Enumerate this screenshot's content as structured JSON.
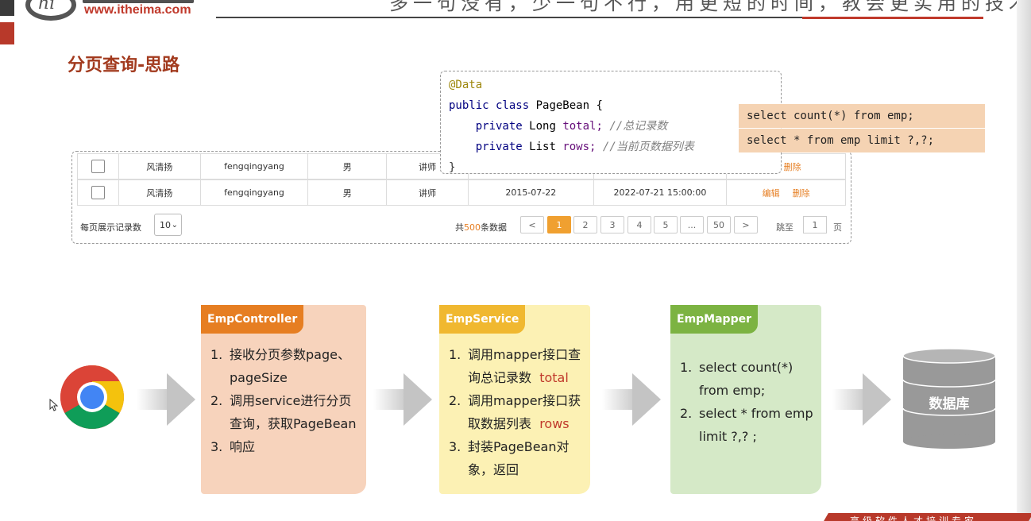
{
  "header": {
    "logo_url_text": "www.itheima.com",
    "slogan": "多一句没有，少一句不行，用更短的时间，教会更实用的技术!"
  },
  "slide": {
    "title": "分页查询-思路"
  },
  "table": {
    "rows": [
      {
        "name": "风清扬",
        "username": "fengqingyang",
        "gender": "男",
        "job": "讲师",
        "entry_date": "",
        "update_time": "",
        "edit": "",
        "delete": "删除"
      },
      {
        "name": "风清扬",
        "username": "fengqingyang",
        "gender": "男",
        "job": "讲师",
        "entry_date": "2015-07-22",
        "update_time": "2022-07-21 15:00:00",
        "edit": "编辑",
        "delete": "删除"
      }
    ]
  },
  "pager": {
    "page_size_label": "每页展示记录数",
    "page_size_value": "10",
    "total_prefix": "共",
    "total_value": "500",
    "total_suffix": "条数据",
    "prev": "<",
    "pages": [
      "1",
      "2",
      "3",
      "4",
      "5",
      "...",
      "50"
    ],
    "active_page": "1",
    "next": ">",
    "jump_label": "跳至",
    "jump_value": "1",
    "page_suffix": "页"
  },
  "code": {
    "annotation": "@Data",
    "class_decl_kw": "public class",
    "class_name": "PageBean {",
    "field1_kw": "private",
    "field1_type": "Long",
    "field1_name": "total;",
    "field1_comment": "//总记录数",
    "field2_kw": "private",
    "field2_type": "List",
    "field2_name": "rows;",
    "field2_comment": "//当前页数据列表",
    "close": "}"
  },
  "sql": {
    "count": "select count(*) from emp;",
    "page": "select * from emp limit ?,?;"
  },
  "flow": {
    "controller": {
      "tag": "EmpController",
      "items": [
        {
          "idx": "1.",
          "text": "接收分页参数page、pageSize"
        },
        {
          "idx": "2.",
          "text": "调用service进行分页查询，获取PageBean"
        },
        {
          "idx": "3.",
          "text": "响应"
        }
      ]
    },
    "service": {
      "tag": "EmpService",
      "item1_idx": "1.",
      "item1_text": "调用mapper接口查询总记录数",
      "item1_hl": "total",
      "item2_idx": "2.",
      "item2_text": "调用mapper接口获取数据列表",
      "item2_hl": "rows",
      "item3_idx": "3.",
      "item3_text": "封装PageBean对象，返回"
    },
    "mapper": {
      "tag": "EmpMapper",
      "items": [
        {
          "idx": "1.",
          "text": "select count(*) from emp;"
        },
        {
          "idx": "2.",
          "text": "select * from emp limit ?,? ;"
        }
      ]
    },
    "db_label": "数据库"
  },
  "footer": {
    "text": "高级软件人才培训专家"
  },
  "colors": {
    "title": "#a23a1e",
    "controller": "#e67e22",
    "service": "#f0b830",
    "mapper": "#7cb342",
    "accent_red": "#c0392b"
  }
}
